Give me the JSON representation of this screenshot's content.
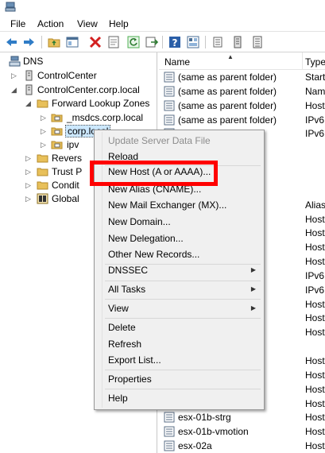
{
  "menubar": {
    "file": "File",
    "action": "Action",
    "view": "View",
    "help": "Help"
  },
  "tree": {
    "root": "DNS",
    "server1": "ControlCenter",
    "server2": "ControlCenter.corp.local",
    "forward_zones": "Forward Lookup Zones",
    "msdcs": "_msdcs.corp.local",
    "corp_local": "corp.local",
    "ipv": "ipv",
    "reverse": "Revers",
    "trust": "Trust P",
    "conditional": "Condit",
    "global": "Global"
  },
  "list": {
    "col_name": "Name",
    "col_type": "Type",
    "rows": [
      {
        "name": "(same as parent folder)",
        "type": "Start"
      },
      {
        "name": "(same as parent folder)",
        "type": "Nam"
      },
      {
        "name": "(same as parent folder)",
        "type": "Host"
      },
      {
        "name": "(same as parent folder)",
        "type": "IPv6"
      },
      {
        "name": "er)",
        "type": "IPv6"
      },
      {
        "name": "",
        "type": ""
      },
      {
        "name": "",
        "type": ""
      },
      {
        "name": "",
        "type": ""
      },
      {
        "name": "",
        "type": ""
      },
      {
        "name": "",
        "type": "Alias"
      },
      {
        "name": "",
        "type": "Host"
      },
      {
        "name": "",
        "type": "Host"
      },
      {
        "name": "",
        "type": "Host"
      },
      {
        "name": "",
        "type": "Host"
      },
      {
        "name": "",
        "type": "IPv6"
      },
      {
        "name": "",
        "type": "IPv6"
      },
      {
        "name": "",
        "type": "Host"
      },
      {
        "name": "",
        "type": "Host"
      },
      {
        "name": "",
        "type": "Host"
      },
      {
        "name": "",
        "type": ""
      },
      {
        "name": "",
        "type": "Host"
      },
      {
        "name": "",
        "type": "Host"
      },
      {
        "name": "",
        "type": "Host"
      },
      {
        "name": "",
        "type": "Host"
      },
      {
        "name": "esx-01b-strg",
        "type": "Host"
      },
      {
        "name": "esx-01b-vmotion",
        "type": "Host"
      },
      {
        "name": "esx-02a",
        "type": "Host"
      }
    ]
  },
  "context_menu": {
    "update_server": "Update Server Data File",
    "reload": "Reload",
    "new_host": "New Host (A or AAAA)...",
    "new_alias": "New Alias (CNAME)...",
    "new_mx": "New Mail Exchanger (MX)...",
    "new_domain": "New Domain...",
    "new_delegation": "New Delegation...",
    "other_records": "Other New Records...",
    "dnssec": "DNSSEC",
    "all_tasks": "All Tasks",
    "view": "View",
    "delete": "Delete",
    "refresh": "Refresh",
    "export_list": "Export List...",
    "properties": "Properties",
    "help": "Help"
  },
  "colors": {
    "highlight": "#ff0000",
    "selection": "#cce8ff",
    "menu_bg": "#f0f0f0"
  },
  "icons": [
    "dns-app-icon",
    "back-arrow-icon",
    "forward-arrow-icon",
    "folder-up-icon",
    "show-hide-tree-icon",
    "delete-x-icon",
    "properties-icon",
    "refresh-icon",
    "export-icon",
    "help-icon",
    "details-icon",
    "server-icon",
    "folder-icon",
    "zone-icon",
    "record-icon"
  ]
}
